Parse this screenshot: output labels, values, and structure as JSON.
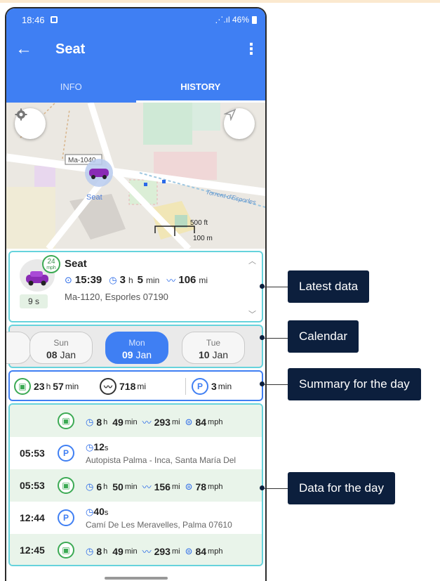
{
  "status_bar": {
    "time": "18:46",
    "right": "⋰.ıl 46%"
  },
  "app_bar": {
    "back_icon": "arrow-left-icon",
    "title": "Seat",
    "more_icon": "more-vert-icon"
  },
  "tabs": [
    {
      "label": "INFO"
    },
    {
      "label": "HISTORY"
    }
  ],
  "map": {
    "road_label": "Ma-1040",
    "car_label": "Seat",
    "stream_label": "Torrent d'Esporles",
    "scale_ft": "500 ft",
    "scale_m": "100 m",
    "settings_icon": "gear-icon",
    "locate_icon": "navigation-arrow-icon"
  },
  "latest": {
    "name": "Seat",
    "speed": "24",
    "speed_unit": "mph",
    "age": "9 s",
    "time": "15:39",
    "duration_h": "3",
    "duration_h_unit": "h",
    "duration_m": "5",
    "duration_m_unit": "min",
    "distance": "106",
    "distance_unit": "mi",
    "address": "Ma-1120, Esporles 07190"
  },
  "calendar": {
    "days": [
      {
        "name": "Sun",
        "num": "08",
        "month": "Jan"
      },
      {
        "name": "Mon",
        "num": "09",
        "month": "Jan"
      },
      {
        "name": "Tue",
        "num": "10",
        "month": "Jan"
      }
    ]
  },
  "summary": {
    "drive_h": "23",
    "drive_m": "57",
    "distance": "718",
    "distance_unit": "mi",
    "park": "3",
    "park_unit": "min"
  },
  "day_rows": [
    {
      "type": "trip",
      "time": "",
      "h": "8",
      "m": "49",
      "dist": "293",
      "speed": "84"
    },
    {
      "type": "park",
      "time": "05:53",
      "duration": "12",
      "duration_unit": "s",
      "address": "Autopista Palma - Inca, Santa María Del"
    },
    {
      "type": "trip",
      "time": "05:53",
      "h": "6",
      "m": "50",
      "dist": "156",
      "speed": "78"
    },
    {
      "type": "park",
      "time": "12:44",
      "duration": "40",
      "duration_unit": "s",
      "address": "Camí De Les Meravelles, Palma 07610"
    },
    {
      "type": "trip",
      "time": "12:45",
      "h": "8",
      "m": "49",
      "dist": "293",
      "speed": "84"
    }
  ],
  "units": {
    "h": "h",
    "min": "min",
    "mi": "mi",
    "mph": "mph",
    "park_letter": "P"
  },
  "callouts": [
    {
      "label": "Latest data"
    },
    {
      "label": "Calendar"
    },
    {
      "label": "Summary for the day"
    },
    {
      "label": "Data for the day"
    }
  ],
  "colors": {
    "primary": "#3f7ff3",
    "accent_border": "#66d3dc",
    "trip_green": "#3caa54",
    "callout_bg": "#0c1f3d"
  }
}
